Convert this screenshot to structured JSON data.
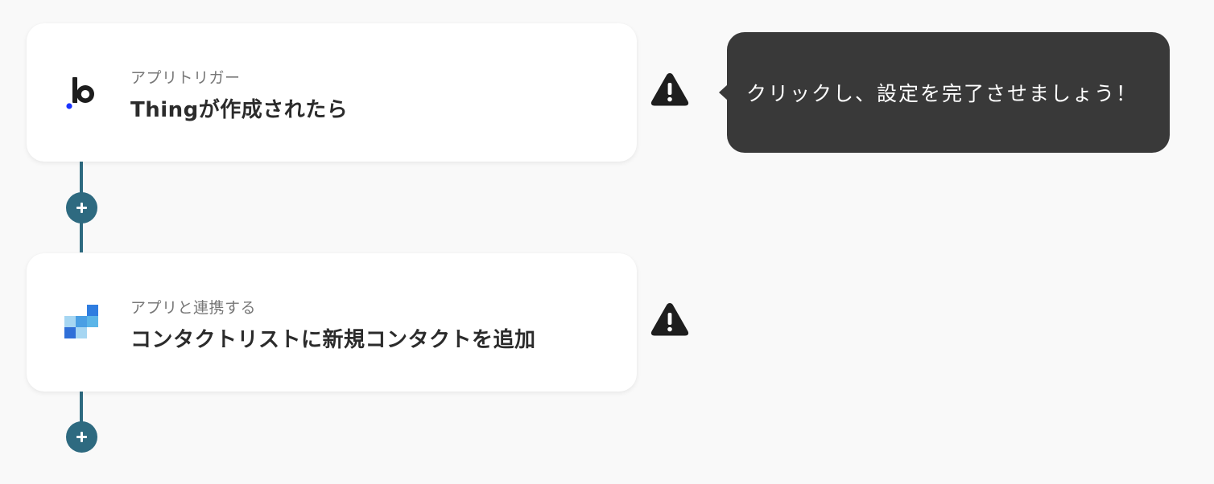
{
  "flow": {
    "steps": [
      {
        "label": "アプリトリガー",
        "title": "Thingが作成されたら",
        "app_icon": "bubble-b-logo-icon",
        "status_icon": "warning-icon"
      },
      {
        "label": "アプリと連携する",
        "title": "コンタクトリストに新規コンタクトを追加",
        "app_icon": "blue-squares-app-icon",
        "status_icon": "warning-icon"
      }
    ],
    "add_step_icon": "plus-icon"
  },
  "tooltip": {
    "text": "クリックし、設定を完了させましょう！"
  },
  "colors": {
    "background": "#f9f9f9",
    "connector": "#2e6a80",
    "tooltip_background": "#393939",
    "warning": "#1e1e1e"
  }
}
